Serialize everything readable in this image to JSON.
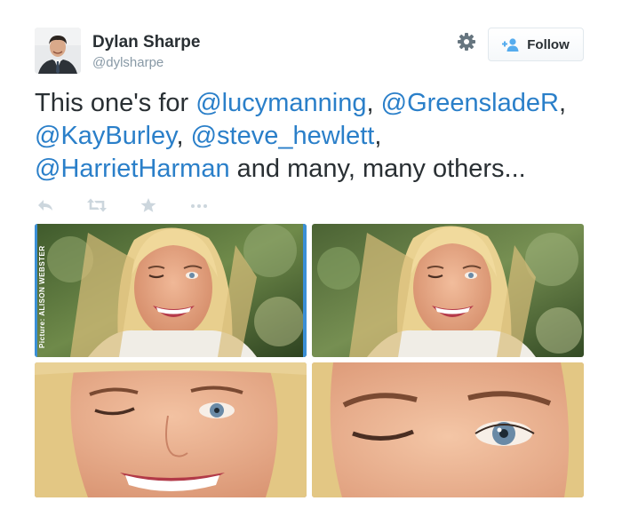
{
  "user": {
    "name": "Dylan Sharpe",
    "handle": "@dylsharpe"
  },
  "follow_button": {
    "label": "Follow"
  },
  "tweet": {
    "lines": [
      [
        {
          "text": "This one's for ",
          "type": "text"
        },
        {
          "text": "@lucymanning",
          "type": "mention"
        },
        {
          "text": ", ",
          "type": "text"
        },
        {
          "text": "@GreensladeR",
          "type": "mention"
        },
        {
          "text": ",",
          "type": "text"
        }
      ],
      [
        {
          "text": "@KayBurley",
          "type": "mention"
        },
        {
          "text": ", ",
          "type": "text"
        },
        {
          "text": "@steve_hewlett",
          "type": "mention"
        },
        {
          "text": ",",
          "type": "text"
        }
      ],
      [
        {
          "text": "@HarrietHarman",
          "type": "mention"
        },
        {
          "text": " and many, many others...",
          "type": "text"
        }
      ]
    ]
  },
  "actions": [
    "reply-icon",
    "retweet-icon",
    "favorite-icon",
    "more-icon"
  ],
  "media": {
    "photo_credit": "Picture: ALISON WEBSTER"
  },
  "colors": {
    "mention": "#2a7fc9",
    "text": "#292f33",
    "muted": "#8899a6",
    "action_icon": "#ccd6dd",
    "frame_accent": "#3b8fd6"
  }
}
